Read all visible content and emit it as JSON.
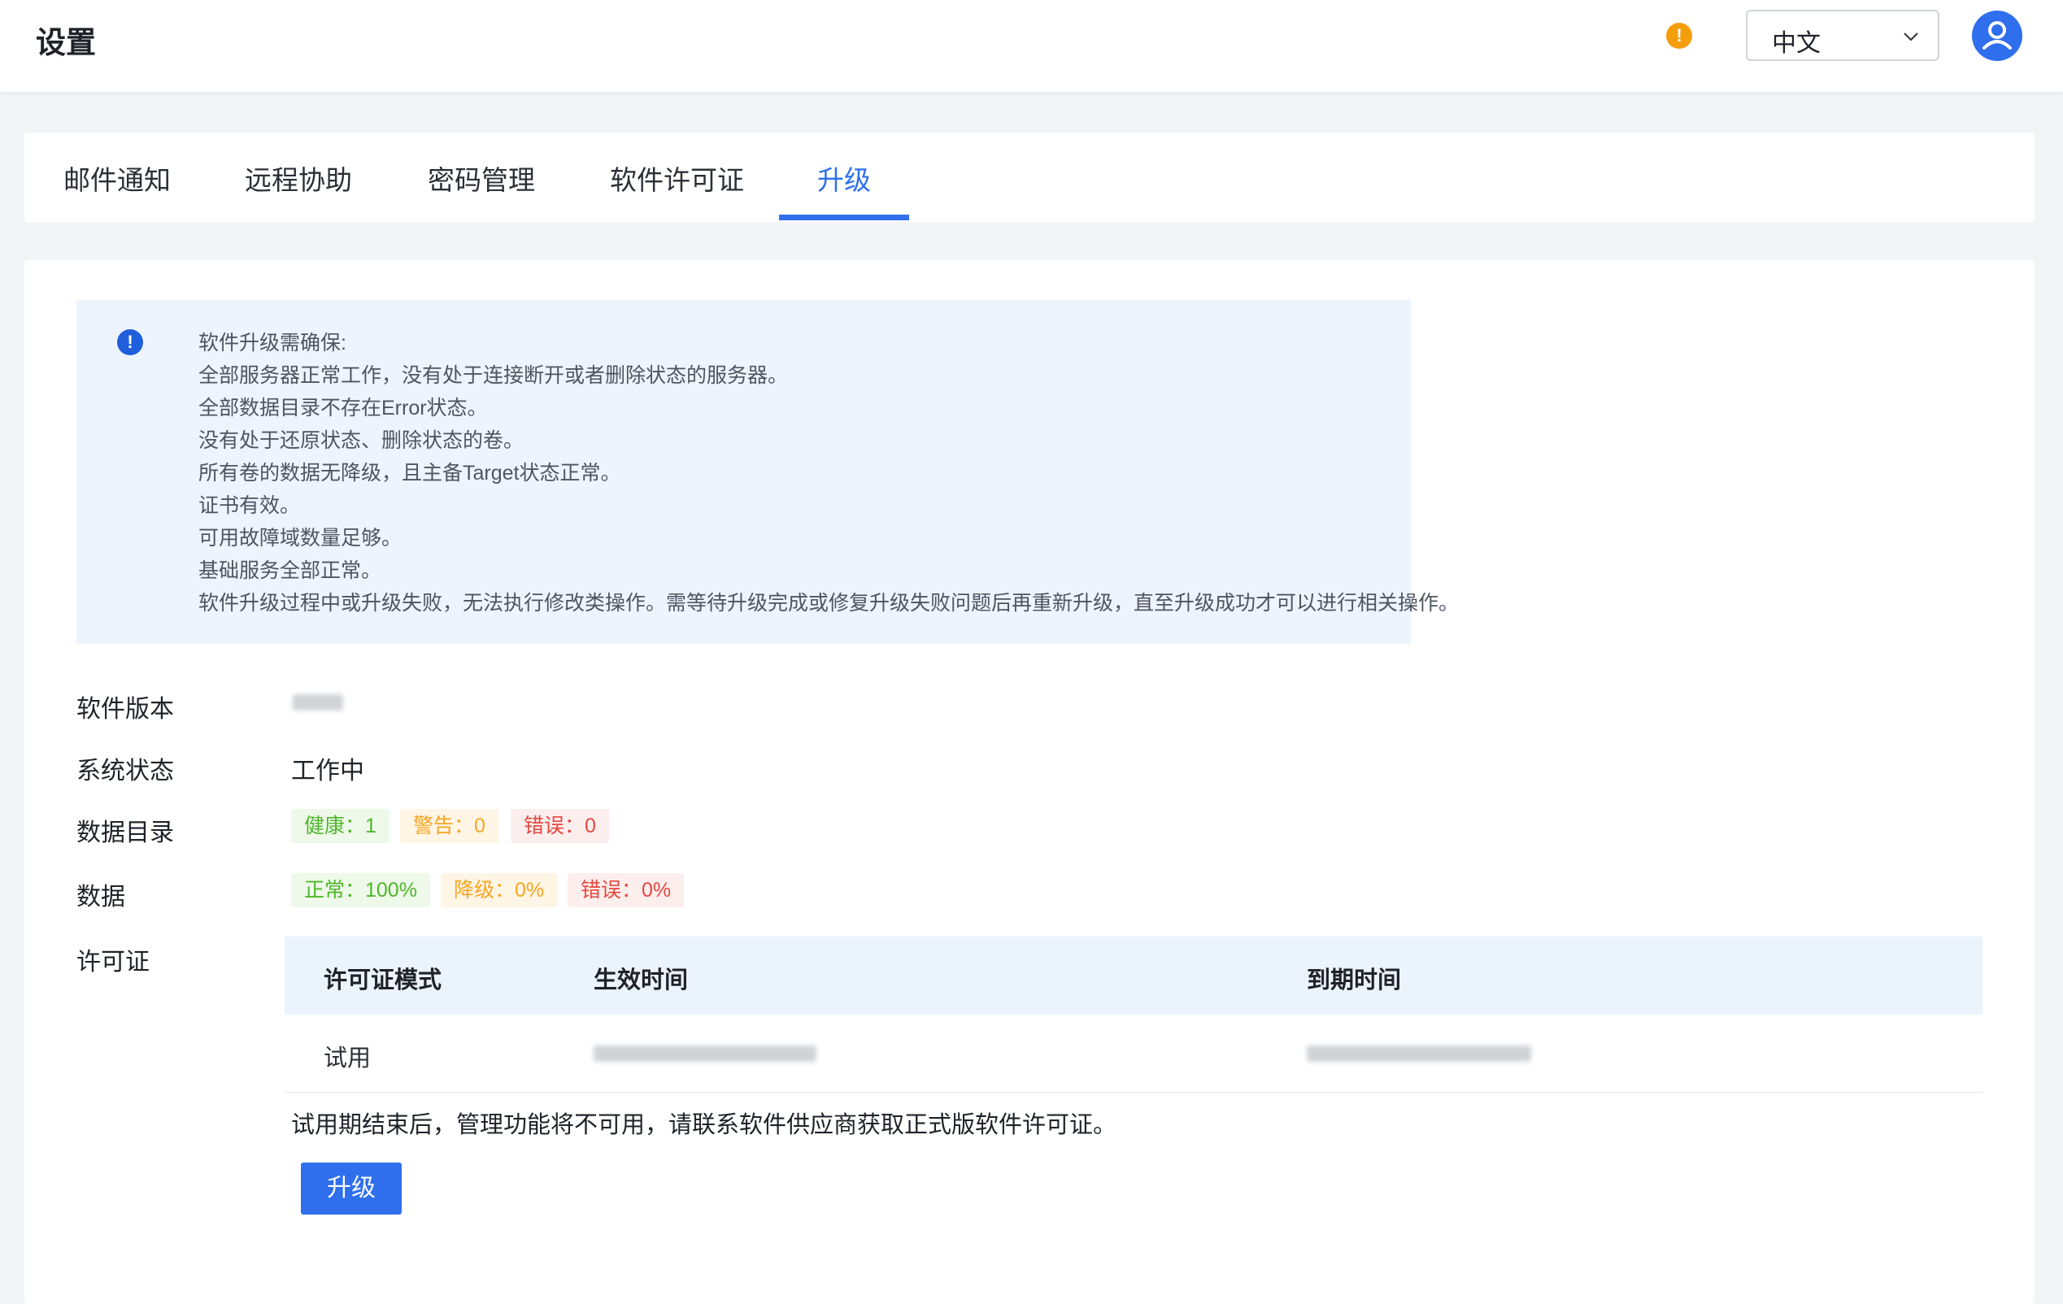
{
  "header": {
    "title": "设置",
    "warning_icon": "warning-icon",
    "language": "中文",
    "avatar_icon": "user-icon"
  },
  "tabs": [
    {
      "label": "邮件通知",
      "active": false
    },
    {
      "label": "远程协助",
      "active": false
    },
    {
      "label": "密码管理",
      "active": false
    },
    {
      "label": "软件许可证",
      "active": false
    },
    {
      "label": "升级",
      "active": true
    }
  ],
  "notice": {
    "icon": "info-icon",
    "lines": [
      "软件升级需确保:",
      "全部服务器正常工作，没有处于连接断开或者删除状态的服务器。",
      "全部数据目录不存在Error状态。",
      "没有处于还原状态、删除状态的卷。",
      "所有卷的数据无降级，且主备Target状态正常。",
      "证书有效。",
      "可用故障域数量足够。",
      "基础服务全部正常。",
      "软件升级过程中或升级失败，无法执行修改类操作。需等待升级完成或修复升级失败问题后再重新升级，直至升级成功才可以进行相关操作。"
    ]
  },
  "info": {
    "software_version_label": "软件版本",
    "system_status_label": "系统状态",
    "system_status_value": "工作中",
    "data_dir_label": "数据目录",
    "data_dir_tags": {
      "healthy": "健康：1",
      "warning": "警告：0",
      "error": "错误：0"
    },
    "data_label": "数据",
    "data_tags": {
      "normal": "正常：100%",
      "degraded": "降级：0%",
      "error": "错误：0%"
    },
    "license_label": "许可证"
  },
  "license_table": {
    "headers": [
      "许可证模式",
      "生效时间",
      "到期时间"
    ],
    "rows": [
      {
        "mode": "试用"
      }
    ]
  },
  "trial_note": "试用期结束后，管理功能将不可用，请联系软件供应商获取正式版软件许可证。",
  "upgrade_button": "升级",
  "colors": {
    "accent": "#2f6fed",
    "warning": "#f59e0b",
    "success": "#4fb62a",
    "error": "#e5483f"
  }
}
